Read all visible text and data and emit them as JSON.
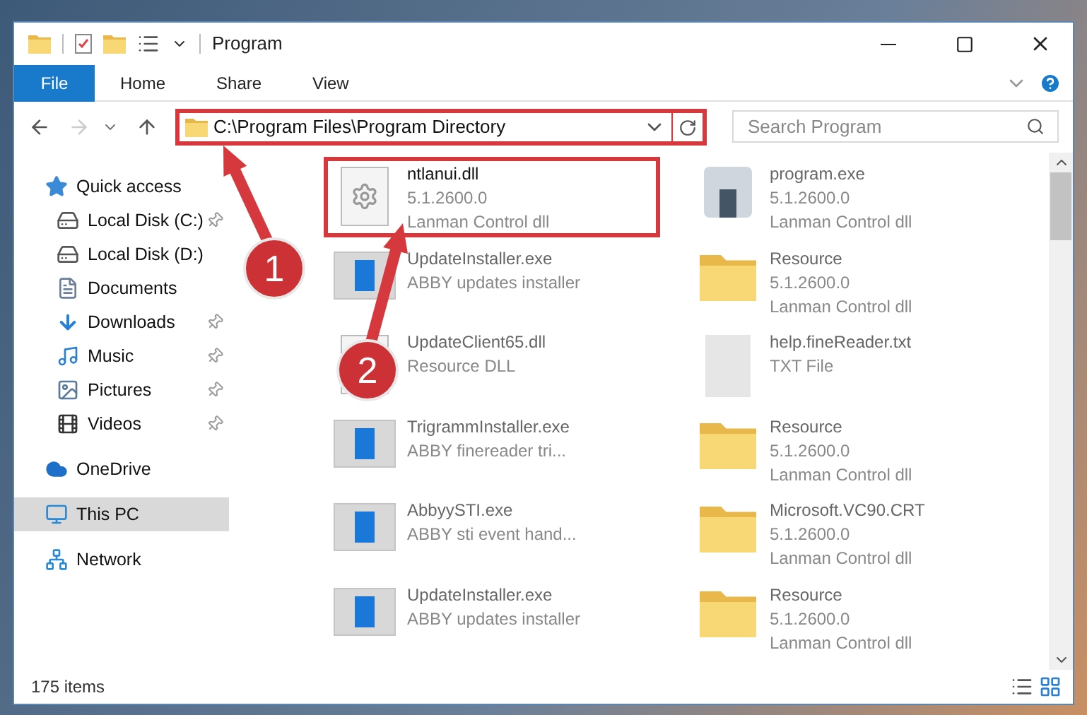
{
  "window": {
    "title": "Program"
  },
  "ribbon_tabs": [
    {
      "label": "File",
      "kind": "file"
    },
    {
      "label": "Home",
      "kind": "tab"
    },
    {
      "label": "Share",
      "kind": "tab"
    },
    {
      "label": "View",
      "kind": "tab"
    }
  ],
  "address": {
    "path": "C:\\Program Files\\Program Directory",
    "highlighted": true
  },
  "search": {
    "placeholder": "Search Program"
  },
  "sidebar": [
    {
      "label": "Quick access",
      "kind": "star",
      "selected": false,
      "children": [
        {
          "label": "Local Disk (C:)",
          "kind": "disk",
          "pinned": true,
          "selected": false
        },
        {
          "label": "Local Disk (D:)",
          "kind": "disk",
          "pinned": false,
          "selected": false
        },
        {
          "label": "Documents",
          "kind": "doc",
          "pinned": false,
          "selected": false
        },
        {
          "label": "Downloads",
          "kind": "down",
          "pinned": true,
          "selected": false
        },
        {
          "label": "Music",
          "kind": "music",
          "pinned": true,
          "selected": false
        },
        {
          "label": "Pictures",
          "kind": "pic",
          "pinned": true,
          "selected": false
        },
        {
          "label": "Videos",
          "kind": "video",
          "pinned": true,
          "selected": false
        }
      ]
    },
    {
      "label": "OneDrive",
      "kind": "cloud",
      "selected": false
    },
    {
      "label": "This PC",
      "kind": "pc",
      "selected": true
    },
    {
      "label": "Network",
      "kind": "net",
      "selected": false
    }
  ],
  "files": [
    {
      "name": "ntlanui.dll",
      "lines": [
        "5.1.2600.0",
        "Lanman Control dll"
      ],
      "kind": "dll",
      "highlighted": true
    },
    {
      "name": "program.exe",
      "lines": [
        "5.1.2600.0",
        "Lanman Control dll"
      ],
      "kind": "exe",
      "highlighted": false
    },
    {
      "name": "UpdateInstaller.exe",
      "lines": [
        "ABBY updates installer"
      ],
      "kind": "app",
      "highlighted": false
    },
    {
      "name": "Resource",
      "lines": [
        "5.1.2600.0",
        "Lanman Control dll"
      ],
      "kind": "folder",
      "highlighted": false
    },
    {
      "name": "UpdateClient65.dll",
      "lines": [
        "Resource DLL"
      ],
      "kind": "dll",
      "highlighted": false
    },
    {
      "name": "help.fineReader.txt",
      "lines": [
        "TXT File"
      ],
      "kind": "txt",
      "highlighted": false
    },
    {
      "name": "TrigrammInstaller.exe",
      "lines": [
        "ABBY finereader tri..."
      ],
      "kind": "app",
      "highlighted": false
    },
    {
      "name": "Resource",
      "lines": [
        "5.1.2600.0",
        "Lanman Control dll"
      ],
      "kind": "folder",
      "highlighted": false
    },
    {
      "name": "AbbyySTI.exe",
      "lines": [
        "ABBY sti event hand..."
      ],
      "kind": "app",
      "highlighted": false
    },
    {
      "name": "Microsoft.VC90.CRT",
      "lines": [
        "5.1.2600.0",
        "Lanman Control dll"
      ],
      "kind": "folder",
      "highlighted": false
    },
    {
      "name": "UpdateInstaller.exe",
      "lines": [
        "ABBY updates installer"
      ],
      "kind": "app",
      "highlighted": false
    },
    {
      "name": "Resource",
      "lines": [
        "5.1.2600.0",
        "Lanman Control dll"
      ],
      "kind": "folder",
      "highlighted": false
    }
  ],
  "status_bar": {
    "count": "175 items"
  },
  "steps": [
    {
      "number": "1"
    },
    {
      "number": "2"
    }
  ]
}
